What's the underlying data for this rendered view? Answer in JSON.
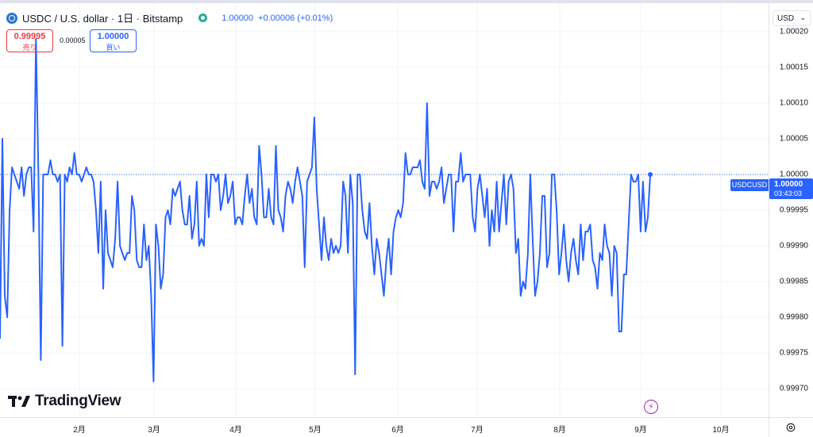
{
  "header": {
    "symbol": "USDC / U.S. dollar · 1日 · Bitstamp",
    "last_value": "1.00000",
    "change": "+0.00006 (+0.01%)"
  },
  "trade": {
    "sell_price": "0.99995",
    "sell_label": "売り",
    "spread": "0.00005",
    "buy_price": "1.00000",
    "buy_label": "買い"
  },
  "currency_selector": "USD",
  "price_label": {
    "symbol": "USDCUSD",
    "price": "1.00000",
    "countdown": "03:43:03"
  },
  "brand": "TradingView",
  "colors": {
    "line": "#2962ff",
    "sell": "#f23645",
    "buy": "#2962ff",
    "status": "#22ab94"
  },
  "chart_data": {
    "type": "line",
    "series": [
      {
        "values": [
          0.99977,
          1.00005,
          0.99983,
          0.9998,
          0.99995,
          1.00001,
          1.0,
          0.99999,
          0.99998,
          1.00001,
          0.99997,
          1.0,
          1.00001,
          1.00001,
          0.99992,
          1.00019,
          1.0,
          0.99974,
          1.0,
          1.0,
          1.0,
          1.00002,
          1.0,
          1.0,
          0.99999,
          1.0,
          0.99976,
          1.0,
          0.99999,
          1.00001,
          1.0,
          1.00003,
          1.0,
          1.0,
          0.99999,
          1.0,
          1.00001,
          1.0,
          1.0,
          0.99999,
          0.99995,
          0.99989,
          0.99999,
          0.99984,
          0.99995,
          0.99989,
          0.99988,
          0.99987,
          0.99991,
          0.99999,
          0.9999,
          0.99989,
          0.99988,
          0.99989,
          0.99989,
          0.99997,
          0.99995,
          0.99988,
          0.99987,
          0.99987,
          0.99993,
          0.99988,
          0.9999,
          0.99983,
          0.99971,
          0.99993,
          0.9999,
          0.99984,
          0.99986,
          0.99994,
          0.99995,
          0.99993,
          0.99998,
          0.99997,
          0.99998,
          0.99999,
          0.99995,
          0.99993,
          0.99993,
          0.99997,
          0.99991,
          0.99993,
          0.99999,
          0.9999,
          0.99991,
          0.9999,
          1.0,
          0.99994,
          1.0,
          1.0,
          0.99999,
          1.0,
          0.99995,
          0.99997,
          1.0,
          0.99996,
          0.99997,
          0.99999,
          0.99993,
          0.99994,
          0.99994,
          0.99993,
          0.99997,
          1.0,
          0.99996,
          0.99998,
          0.99994,
          0.99993,
          1.00004,
          1.0,
          0.99994,
          0.99994,
          0.99998,
          0.99994,
          0.99993,
          1.00004,
          0.99995,
          0.99994,
          0.99992,
          0.99997,
          0.99999,
          0.99998,
          0.99996,
          0.99999,
          1.00001,
          0.99999,
          0.99997,
          0.99987,
          0.99999,
          1.0,
          1.00001,
          1.00008,
          0.99998,
          0.99993,
          0.99988,
          0.99994,
          0.9999,
          0.99988,
          0.99991,
          0.99989,
          0.9999,
          0.99989,
          0.9999,
          0.99999,
          0.99997,
          0.99989,
          1.0,
          0.99996,
          0.99972,
          1.0,
          1.0,
          0.99995,
          0.99992,
          0.99991,
          0.99996,
          0.9999,
          0.99986,
          0.99991,
          0.99989,
          0.99986,
          0.99983,
          0.99988,
          0.99991,
          0.99986,
          0.99992,
          0.99994,
          0.99995,
          0.99994,
          0.99996,
          1.00003,
          1.0,
          1.0,
          1.00001,
          1.00001,
          1.00001,
          1.00002,
          0.99999,
          0.99998,
          1.0001,
          0.99997,
          0.99999,
          0.99999,
          0.99998,
          0.99999,
          1.00001,
          0.99996,
          0.99998,
          1.0,
          1.0,
          0.99992,
          0.99999,
          0.99999,
          1.00003,
          0.99999,
          1.0,
          1.0,
          1.0,
          0.99994,
          0.99992,
          0.99998,
          1.0,
          0.99997,
          0.99994,
          0.99998,
          0.9999,
          0.99995,
          0.99992,
          0.99999,
          0.99992,
          0.99996,
          1.0,
          0.99993,
          0.99999,
          1.0,
          0.99998,
          0.99989,
          0.99991,
          0.99983,
          0.99985,
          0.99984,
          0.99989,
          1.0,
          0.99991,
          0.99983,
          0.99985,
          0.99989,
          0.99997,
          0.99997,
          0.99987,
          0.99989,
          1.0,
          1.0,
          0.99995,
          0.99986,
          0.99989,
          0.99993,
          0.99988,
          0.99985,
          0.99989,
          0.99991,
          0.99988,
          0.99986,
          0.99993,
          0.99988,
          0.99992,
          0.99992,
          0.99993,
          0.99988,
          0.99987,
          0.99984,
          0.99989,
          0.99988,
          0.99993,
          0.9999,
          0.99989,
          0.99983,
          0.9999,
          0.99989,
          0.99978,
          0.99978,
          0.99986,
          0.99986,
          0.99993,
          1.0,
          0.99999,
          0.99999,
          1.0,
          0.99992,
          0.99999,
          0.99992,
          0.99994,
          1.0
        ]
      }
    ],
    "x_labels": [
      "2月",
      "3月",
      "4月",
      "5月",
      "6月",
      "7月",
      "8月",
      "9月",
      "10月"
    ],
    "y_ticks": [
      "1.00020",
      "1.00015",
      "1.00010",
      "1.00005",
      "1.00000",
      "0.99995",
      "0.99990",
      "0.99985",
      "0.99980",
      "0.99975",
      "0.99970"
    ],
    "ylim": [
      0.99966,
      1.00024
    ],
    "grid": true,
    "reference_line": 1.0
  }
}
